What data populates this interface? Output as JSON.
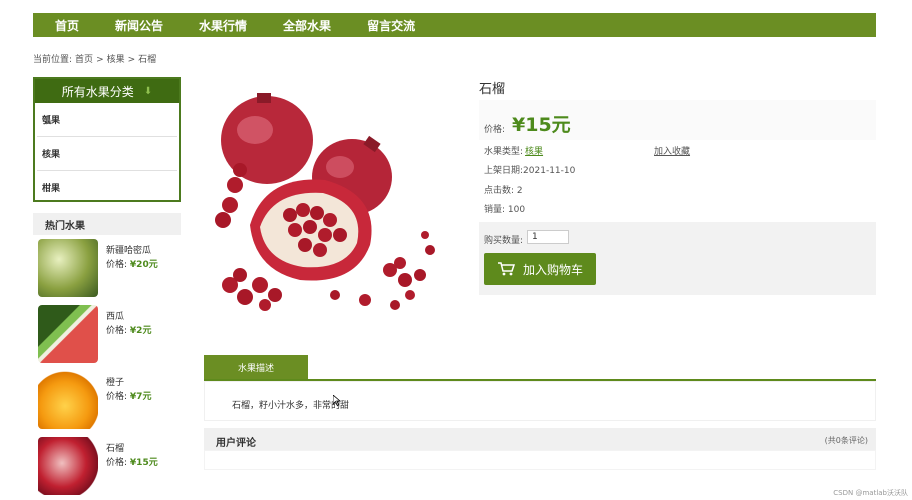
{
  "nav": {
    "items": [
      "首页",
      "新闻公告",
      "水果行情",
      "全部水果",
      "留言交流"
    ]
  },
  "breadcrumb": {
    "prefix": "当前位置:",
    "home": "首页",
    "sep": ">",
    "category": "核果",
    "current": "石榴"
  },
  "categories": {
    "title": "所有水果分类",
    "items": [
      "瓠果",
      "核果",
      "柑果"
    ]
  },
  "hot": {
    "title": "热门水果",
    "price_label": "价格:",
    "items": [
      {
        "name": "新疆哈密瓜",
        "price": "¥20元"
      },
      {
        "name": "西瓜",
        "price": "¥2元"
      },
      {
        "name": "橙子",
        "price": "¥7元"
      },
      {
        "name": "石榴",
        "price": "¥15元"
      }
    ]
  },
  "product": {
    "name": "石榴",
    "price_label": "价格:",
    "price": "¥15元",
    "type_label": "水果类型:",
    "type": "核果",
    "favorite": "加入收藏",
    "date_label": "上架日期:",
    "date": "2021-11-10",
    "clicks_label": "点击数:",
    "clicks": "2",
    "sales_label": "销量:",
    "sales": "100",
    "qty_label": "购买数量:",
    "qty": "1",
    "cart_button": "加入购物车"
  },
  "tabs": {
    "desc": "水果描述"
  },
  "description": "石榴，籽小汁水多，非常的甜",
  "comments": {
    "title": "用户评论",
    "count": "(共0条评论)"
  },
  "watermark": "CSDN @matlab沃沃队",
  "colors": {
    "nav": "#6b8e23",
    "price": "#4d8a1c",
    "button": "#5e8a1c"
  }
}
